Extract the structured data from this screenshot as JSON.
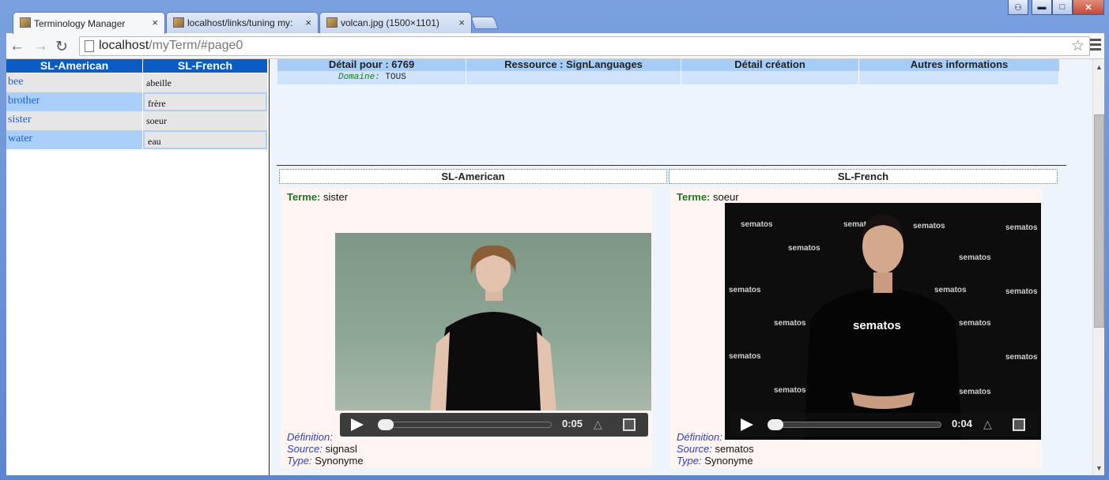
{
  "browser": {
    "tabs": [
      {
        "title": "Terminology Manager",
        "close": "×"
      },
      {
        "title": "localhost/links/tuning my:",
        "close": "×"
      },
      {
        "title": "volcan.jpg (1500×1101)",
        "close": "×"
      }
    ],
    "url_host": "localhost",
    "url_path": "/myTerm/#page0",
    "window_buttons": [
      "user",
      "minimize",
      "maximize",
      "close"
    ]
  },
  "left_table": {
    "headers": [
      "SL-American",
      "SL-French"
    ],
    "rows": [
      {
        "en": "bee",
        "fr": "abeille"
      },
      {
        "en": "brother",
        "fr": "frère"
      },
      {
        "en": "sister",
        "fr": "soeur"
      },
      {
        "en": "water",
        "fr": "eau"
      }
    ]
  },
  "detail": {
    "headers": [
      "Détail pour : 6769",
      "Ressource : SignLanguages",
      "Détail création",
      "Autres informations"
    ],
    "domaine_label": "Domaine:",
    "domaine_value": "TOUS"
  },
  "columns": [
    {
      "header": "SL-American",
      "term_label": "Terme:",
      "term": "sister",
      "definition_label": "Définition:",
      "source_label": "Source:",
      "source": "signasl",
      "type_label": "Type:",
      "type": "Synonyme",
      "video_time": "0:05"
    },
    {
      "header": "SL-French",
      "term_label": "Terme:",
      "term": "soeur",
      "definition_label": "Définition:",
      "source_label": "Source:",
      "source": "sematos",
      "type_label": "Type:",
      "type": "Synonyme",
      "video_time": "0:04",
      "logo": "sematos"
    }
  ],
  "colors": {
    "header_blue": "#0a5bc4",
    "link_blue": "#1e62c9",
    "term_green": "#1b7a1b",
    "meta_blue": "#2b3fc9"
  }
}
